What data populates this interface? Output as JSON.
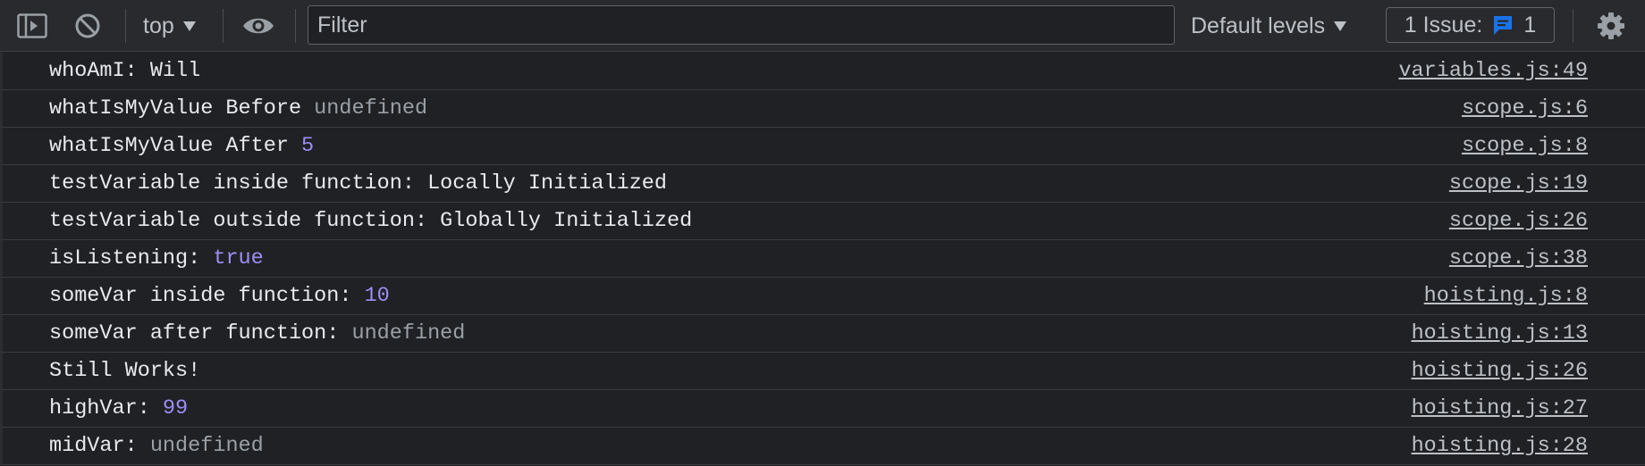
{
  "toolbar": {
    "context": "top",
    "filter_placeholder": "Filter",
    "levels_label": "Default levels",
    "issues_label": "1 Issue:",
    "issues_count": "1"
  },
  "colors": {
    "background": "#202124",
    "toolbar": "#292a2d",
    "text": "#e8eaed",
    "muted": "#9aa0a6",
    "number": "#9d8df7",
    "issue_icon": "#1a73e8"
  },
  "icons": {
    "sidebar": "sidebar-toggle-icon",
    "clear": "clear-console-icon",
    "live_expression": "eye-icon",
    "settings": "gear-icon",
    "issue": "message-icon"
  },
  "logs": [
    {
      "text": "whoAmI: Will",
      "value": "",
      "value_type": "",
      "source": "variables.js:49"
    },
    {
      "text": "whatIsMyValue Before ",
      "value": "undefined",
      "value_type": "undefined",
      "source": "scope.js:6"
    },
    {
      "text": "whatIsMyValue After ",
      "value": "5",
      "value_type": "number",
      "source": "scope.js:8"
    },
    {
      "text": "testVariable inside function: Locally Initialized",
      "value": "",
      "value_type": "",
      "source": "scope.js:19"
    },
    {
      "text": "testVariable outside function: Globally Initialized",
      "value": "",
      "value_type": "",
      "source": "scope.js:26"
    },
    {
      "text": "isListening: ",
      "value": "true",
      "value_type": "boolean",
      "source": "scope.js:38"
    },
    {
      "text": "someVar inside function: ",
      "value": "10",
      "value_type": "number",
      "source": "hoisting.js:8"
    },
    {
      "text": "someVar after function: ",
      "value": "undefined",
      "value_type": "undefined",
      "source": "hoisting.js:13"
    },
    {
      "text": "Still Works!",
      "value": "",
      "value_type": "",
      "source": "hoisting.js:26"
    },
    {
      "text": "highVar: ",
      "value": "99",
      "value_type": "number",
      "source": "hoisting.js:27"
    },
    {
      "text": "midVar: ",
      "value": "undefined",
      "value_type": "undefined",
      "source": "hoisting.js:28"
    }
  ]
}
